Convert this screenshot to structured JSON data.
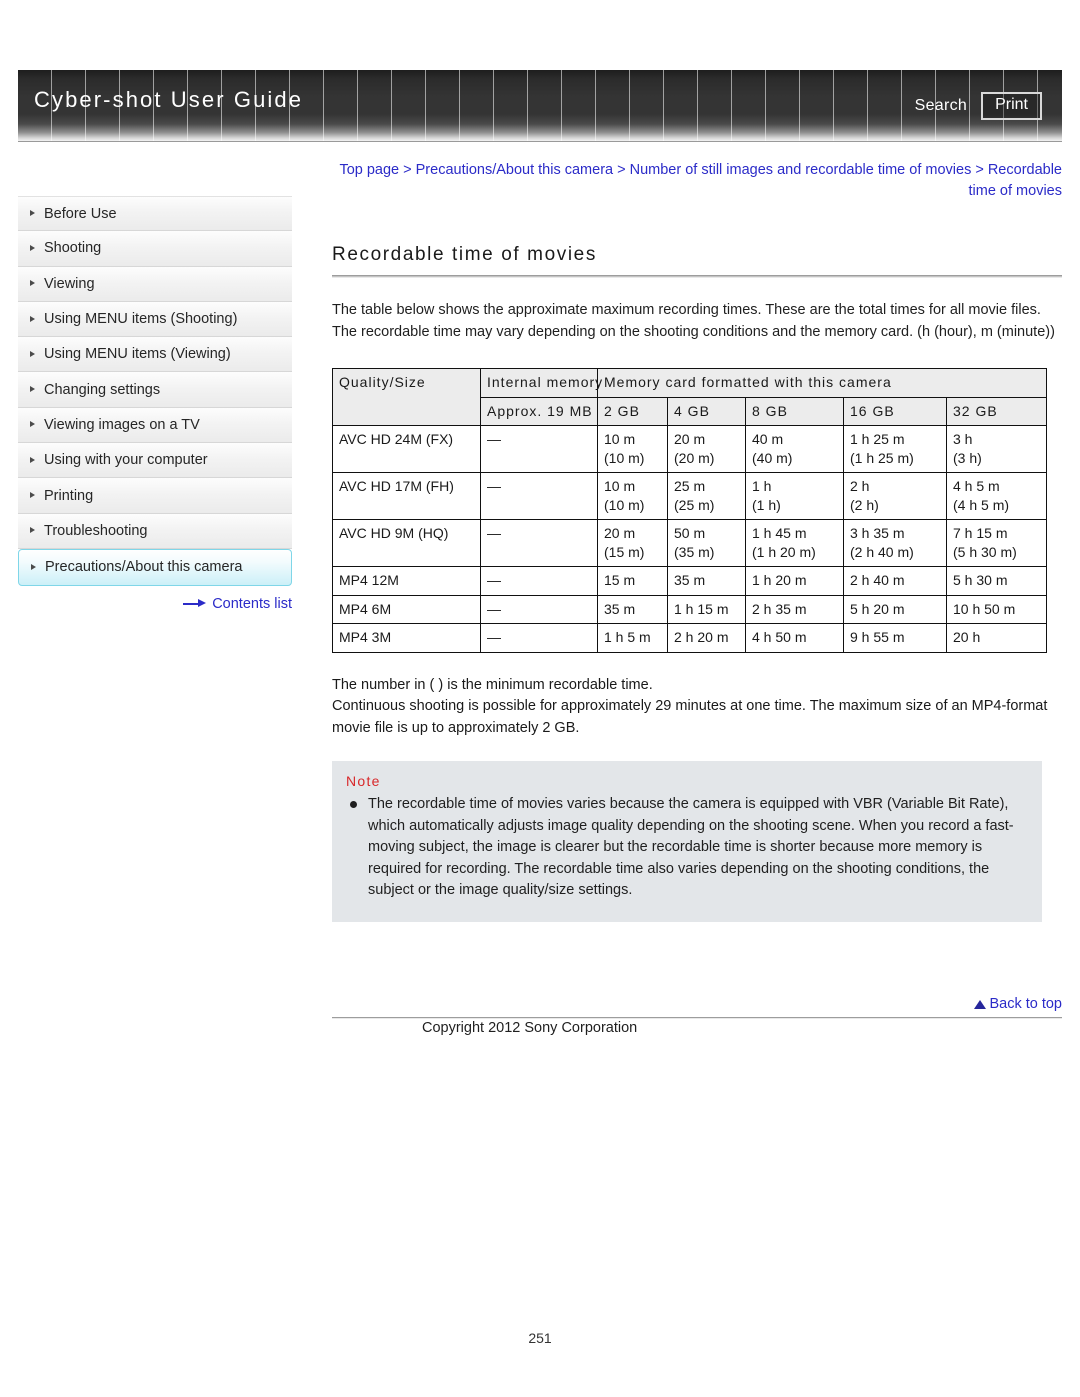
{
  "header": {
    "title": "Cyber-shot User Guide",
    "search_label": "Search",
    "print_label": "Print"
  },
  "breadcrumb": {
    "text": "Top page > Precautions/About this camera > Number of still images and recordable time of movies > Recordable time of movies"
  },
  "sidebar": {
    "items": [
      {
        "label": "Before Use",
        "active": false
      },
      {
        "label": "Shooting",
        "active": false
      },
      {
        "label": "Viewing",
        "active": false
      },
      {
        "label": "Using MENU items (Shooting)",
        "active": false
      },
      {
        "label": "Using MENU items (Viewing)",
        "active": false
      },
      {
        "label": "Changing settings",
        "active": false
      },
      {
        "label": "Viewing images on a TV",
        "active": false
      },
      {
        "label": "Using with your computer",
        "active": false
      },
      {
        "label": "Printing",
        "active": false
      },
      {
        "label": "Troubleshooting",
        "active": false
      },
      {
        "label": "Precautions/About this camera",
        "active": true
      }
    ],
    "contents_link": "Contents list"
  },
  "main": {
    "title": "Recordable time of movies",
    "intro": "The table below shows the approximate maximum recording times. These are the total times for all movie files. The recordable time may vary depending on the shooting conditions and the memory card. (h (hour), m (minute))",
    "table": {
      "group_headers": {
        "quality": "Quality/Size",
        "internal": "Internal memory",
        "memory_card": "Memory card formatted with this camera"
      },
      "size_headers": [
        "Approx. 19 MB",
        "2 GB",
        "4 GB",
        "8 GB",
        "16 GB",
        "32 GB"
      ],
      "rows": [
        {
          "quality": "AVC HD 24M (FX)",
          "internal": "—",
          "cells": [
            {
              "main": "10 m",
              "min": "(10 m)"
            },
            {
              "main": "20 m",
              "min": "(20 m)"
            },
            {
              "main": "40 m",
              "min": "(40 m)"
            },
            {
              "main": "1 h 25 m",
              "min": "(1 h 25 m)"
            },
            {
              "main": "3 h",
              "min": "(3 h)"
            }
          ]
        },
        {
          "quality": "AVC HD 17M (FH)",
          "internal": "—",
          "cells": [
            {
              "main": "10 m",
              "min": "(10 m)"
            },
            {
              "main": "25 m",
              "min": "(25 m)"
            },
            {
              "main": "1 h",
              "min": "(1 h)"
            },
            {
              "main": "2 h",
              "min": "(2 h)"
            },
            {
              "main": "4 h 5 m",
              "min": "(4 h 5 m)"
            }
          ]
        },
        {
          "quality": "AVC HD 9M (HQ)",
          "internal": "—",
          "cells": [
            {
              "main": "20 m",
              "min": "(15 m)"
            },
            {
              "main": "50 m",
              "min": "(35 m)"
            },
            {
              "main": "1 h 45 m",
              "min": "(1 h 20 m)"
            },
            {
              "main": "3 h 35 m",
              "min": "(2 h 40 m)"
            },
            {
              "main": "7 h 15 m",
              "min": "(5 h 30 m)"
            }
          ]
        },
        {
          "quality": "MP4 12M",
          "internal": "—",
          "cells": [
            {
              "main": "15 m",
              "min": ""
            },
            {
              "main": "35 m",
              "min": ""
            },
            {
              "main": "1 h 20 m",
              "min": ""
            },
            {
              "main": "2 h 40 m",
              "min": ""
            },
            {
              "main": "5 h 30 m",
              "min": ""
            }
          ]
        },
        {
          "quality": "MP4 6M",
          "internal": "—",
          "cells": [
            {
              "main": "35 m",
              "min": ""
            },
            {
              "main": "1 h 15 m",
              "min": ""
            },
            {
              "main": "2 h 35 m",
              "min": ""
            },
            {
              "main": "5 h 20 m",
              "min": ""
            },
            {
              "main": "10 h 50 m",
              "min": ""
            }
          ]
        },
        {
          "quality": "MP4 3M",
          "internal": "—",
          "cells": [
            {
              "main": "1 h 5 m",
              "min": ""
            },
            {
              "main": "2 h 20 m",
              "min": ""
            },
            {
              "main": "4 h 50 m",
              "min": ""
            },
            {
              "main": "9 h 55 m",
              "min": ""
            },
            {
              "main": "20 h",
              "min": ""
            }
          ]
        }
      ]
    },
    "post_table_lines": [
      "The number in ( ) is the minimum recordable time.",
      "Continuous shooting is possible for approximately 29 minutes at one time. The maximum size of an MP4-format movie file is up to approximately 2 GB."
    ],
    "note": {
      "heading": "Note",
      "body": "The recordable time of movies varies because the camera is equipped with VBR (Variable Bit Rate), which automatically adjusts image quality depending on the shooting scene. When you record a fast-moving subject, the image is clearer but the recordable time is shorter because more memory is required for recording. The recordable time also varies depending on the shooting conditions, the subject or the image quality/size settings."
    }
  },
  "footer": {
    "back_to_top": "Back to top",
    "copyright": "Copyright 2012 Sony Corporation",
    "page_number": "251"
  },
  "colors": {
    "link": "#2b2bc8",
    "note_heading": "#d8282a",
    "note_bg": "#e3e6e9",
    "sidebar_active": "#ccf0f8"
  }
}
